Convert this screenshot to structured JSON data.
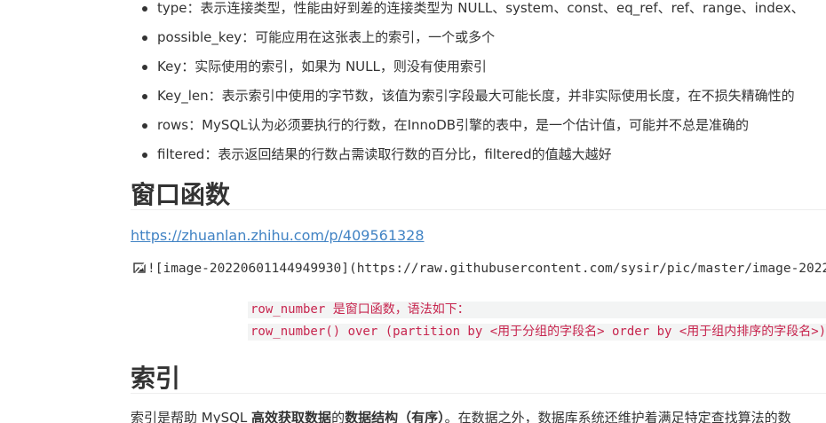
{
  "bullets": [
    {
      "text": "type：表示连接类型，性能由好到差的连接类型为 NULL、system、const、eq_ref、ref、range、index、"
    },
    {
      "text": "possible_key：可能应用在这张表上的索引，一个或多个"
    },
    {
      "text": "Key：实际使用的索引，如果为 NULL，则没有使用索引"
    },
    {
      "text": "Key_len：表示索引中使用的字节数，该值为索引字段最大可能长度，并非实际使用长度，在不损失精确性的"
    },
    {
      "text": "rows：MySQL认为必须要执行的行数，在InnoDB引擎的表中，是一个估计值，可能并不总是准确的"
    },
    {
      "text": "filtered：表示返回结果的行数占需读取行数的百分比，filtered的值越大越好"
    }
  ],
  "section_window": {
    "title": "窗口函数",
    "link": "https://zhuanlan.zhihu.com/p/409561328",
    "image_markdown": "![image-20220601144949930](https://raw.githubusercontent.com/sysir/pic/master/image-2022",
    "code_lines": [
      "row_number 是窗口函数，语法如下：",
      "row_number() over (partition by <用于分组的字段名> order by <用于组内排序的字段名>)"
    ]
  },
  "section_index": {
    "title": "索引",
    "para_start": "索引是帮助 MySQL ",
    "para_bold1": "高效获取数据",
    "para_mid": "的",
    "para_bold2": "数据结构（有序）",
    "para_end": "。在数据之外，数据库系统还维护着满足特定查找算法的数"
  },
  "icons": {
    "broken_image": "broken-image-icon"
  },
  "colors": {
    "text": "#333333",
    "link": "#4183c4",
    "code_text": "#c7254e",
    "code_bg": "#f3f4f4"
  }
}
